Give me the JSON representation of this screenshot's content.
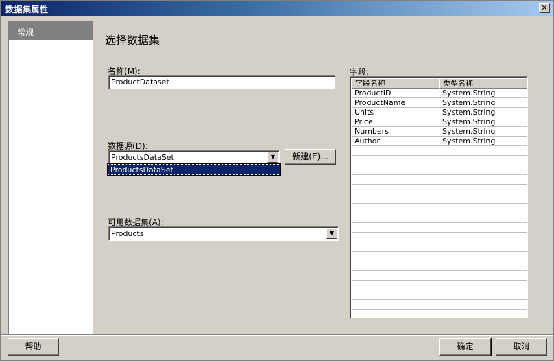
{
  "window": {
    "title": "数据集属性",
    "close_label": "✕"
  },
  "nav": {
    "items": [
      {
        "label": "常规"
      }
    ]
  },
  "main": {
    "section_title": "选择数据集",
    "name_label": "名称(",
    "name_key": "M",
    "name_label_end": "):",
    "name_value": "ProductDataset",
    "datasource_label": "数据源(",
    "datasource_key": "D",
    "datasource_label_end": "):",
    "datasource_value": "ProductsDataSet",
    "datasource_dropdown_item": "ProductsDataSet",
    "new_button_label": "新建(E)...",
    "available_label": "可用数据集(",
    "available_key": "A",
    "available_label_end": "):",
    "available_value": "Products"
  },
  "fields": {
    "label": "字段:",
    "columns": [
      "字段名称",
      "类型名称"
    ],
    "rows": [
      [
        "ProductID",
        "System.String"
      ],
      [
        "ProductName",
        "System.String"
      ],
      [
        "Units",
        "System.String"
      ],
      [
        "Price",
        "System.String"
      ],
      [
        "Numbers",
        "System.String"
      ],
      [
        "Author",
        "System.String"
      ]
    ]
  },
  "footer": {
    "help_label": "帮助",
    "ok_label": "确定",
    "cancel_label": "取消"
  },
  "colors": {
    "titlebar_start": "#0a246a",
    "titlebar_end": "#a6caf0",
    "dialog_bg": "#d4d0c8",
    "selection": "#0a246a"
  }
}
